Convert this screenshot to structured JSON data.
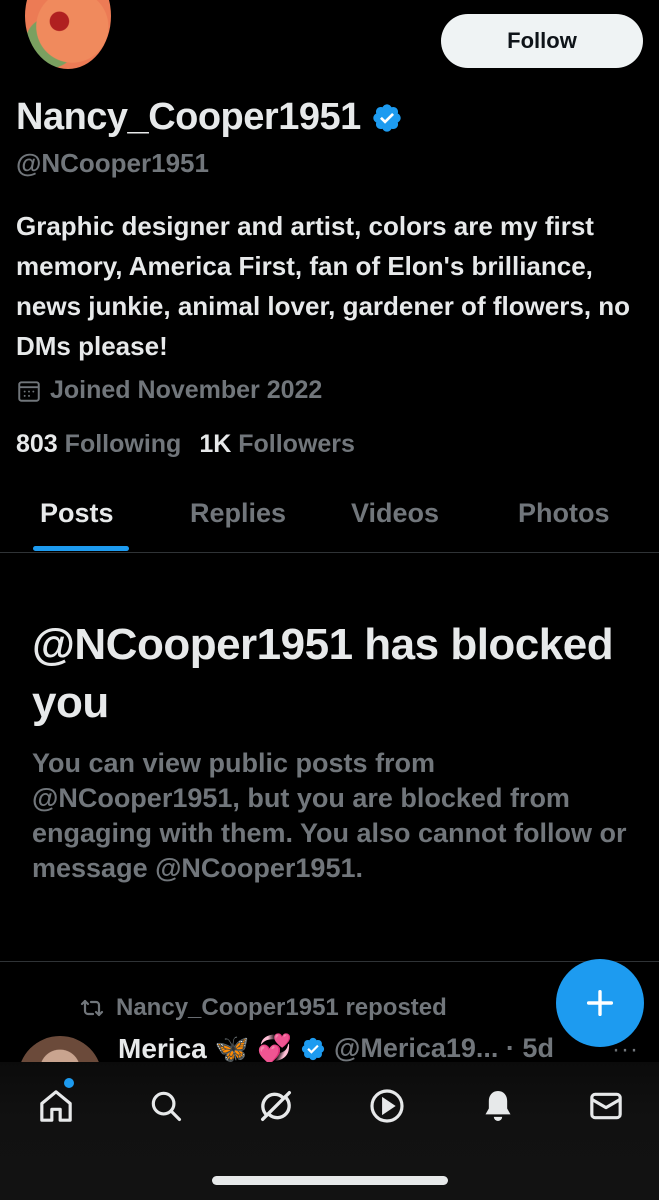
{
  "profile": {
    "display_name": "Nancy_Cooper1951",
    "handle": "@NCooper1951",
    "bio": "Graphic designer and artist, colors are my first memory, America First, fan of Elon's brilliance, news junkie, animal lover, gardener of flowers, no DMs please!",
    "joined": "Joined November 2022",
    "following_count": "803",
    "following_label": "Following",
    "followers_count": "1K",
    "followers_label": "Followers"
  },
  "actions": {
    "follow_label": "Follow"
  },
  "tabs": [
    {
      "label": "Posts",
      "active": true
    },
    {
      "label": "Replies",
      "active": false
    },
    {
      "label": "Videos",
      "active": false
    },
    {
      "label": "Photos",
      "active": false
    }
  ],
  "blocked": {
    "title": "@NCooper1951 has blocked you",
    "description": "You can view public posts from @NCooper1951, but you are blocked from engaging with them. You also cannot follow or message @NCooper1951."
  },
  "post": {
    "repost_text": "Nancy_Cooper1951 reposted",
    "author_name": "Merica 🦋 💞",
    "author_handle_time": "@Merica19... · 5d",
    "more": "···"
  },
  "icons": {
    "verified": "verified-badge-icon",
    "calendar": "calendar-icon",
    "repost": "repost-icon",
    "compose": "plus-icon",
    "nav": [
      "home-icon",
      "search-icon",
      "grok-icon",
      "play-icon",
      "bell-icon",
      "mail-icon"
    ]
  },
  "colors": {
    "accent": "#1d9bf0",
    "muted": "#71767b",
    "text": "#e7e9ea",
    "background": "#000000"
  }
}
